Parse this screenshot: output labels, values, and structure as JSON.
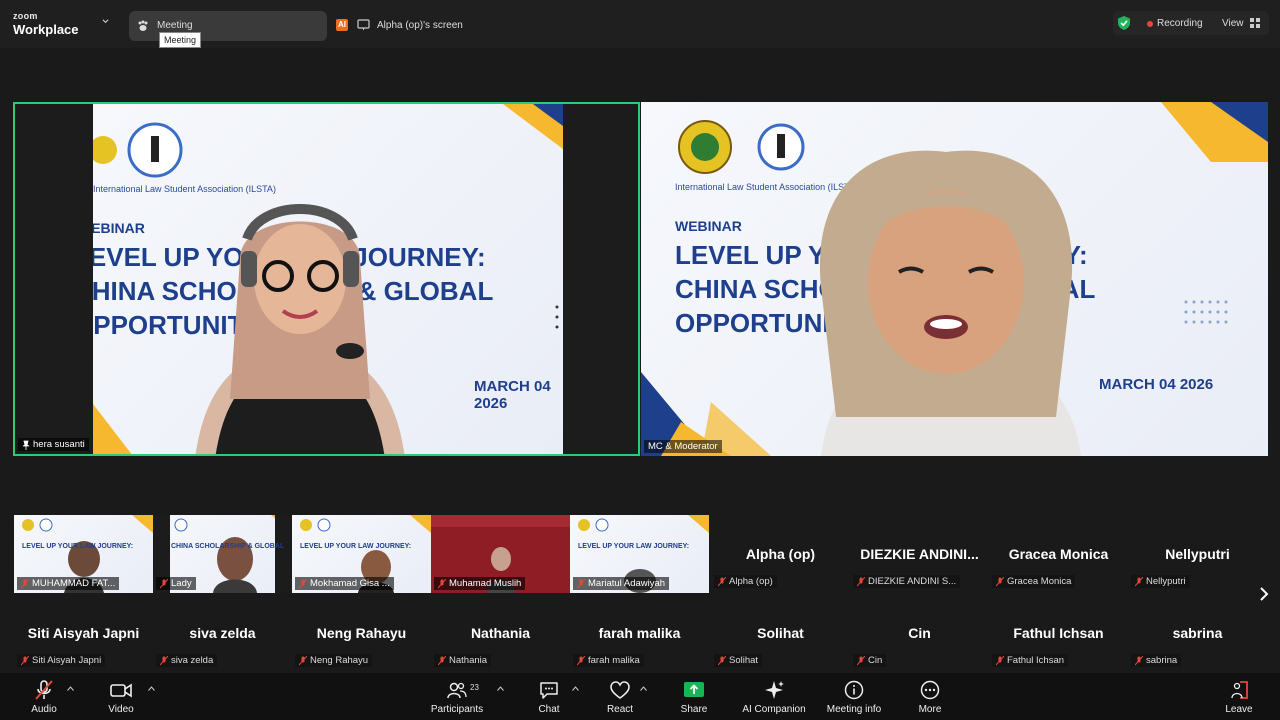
{
  "app": {
    "brand_small": "zoom",
    "brand": "Workplace"
  },
  "header": {
    "meeting_label": "Meeting",
    "tooltip": "Meeting",
    "ai_badge": "AI",
    "screen_share_label": "Alpha (op)'s screen",
    "recording_label": "Recording",
    "view_label": "View"
  },
  "slide": {
    "org": "International Law Student Association (ILSTA)",
    "webinar": "WEBINAR",
    "title_l1": "LEVEL UP YOUR LAW JOURNEY:",
    "title_l2": "CHINA SCHOLARSHIP & GLOBAL",
    "title_l3": "OPPORTUNITIES",
    "date": "MARCH 04 2026"
  },
  "main_tiles": [
    {
      "name": "hera susanti"
    },
    {
      "name": "MC & Moderator"
    }
  ],
  "gallery_row1": [
    {
      "name": "MUHAMMAD FAT..."
    },
    {
      "name": "Lady"
    },
    {
      "name": "Mokhamad Gisa ..."
    },
    {
      "name": "Muhamad Muslih"
    },
    {
      "name": "Mariatul Adawiyah"
    }
  ],
  "name_tiles_row1": [
    {
      "big": "Alpha (op)",
      "small": "Alpha (op)"
    },
    {
      "big": "DIEZKIE  ANDINI...",
      "small": "DIEZKIE ANDINI S..."
    },
    {
      "big": "Gracea Monica",
      "small": "Gracea Monica"
    },
    {
      "big": "Nellyputri",
      "small": "Nellyputri"
    }
  ],
  "name_tiles_row2": [
    {
      "big": "Siti Aisyah Japni",
      "small": "Siti Aisyah Japni"
    },
    {
      "big": "siva zelda",
      "small": "siva zelda"
    },
    {
      "big": "Neng Rahayu",
      "small": "Neng Rahayu"
    },
    {
      "big": "Nathania",
      "small": "Nathania"
    },
    {
      "big": "farah malika",
      "small": "farah malika"
    },
    {
      "big": "Solihat",
      "small": "Solihat"
    },
    {
      "big": "Cin",
      "small": "Cin"
    },
    {
      "big": "Fathul Ichsan",
      "small": "Fathul Ichsan"
    },
    {
      "big": "sabrina",
      "small": "sabrina"
    }
  ],
  "toolbar": {
    "audio": "Audio",
    "video": "Video",
    "participants": "Participants",
    "participants_count": "23",
    "chat": "Chat",
    "react": "React",
    "share": "Share",
    "ai_companion": "AI Companion",
    "meeting_info": "Meeting info",
    "more": "More",
    "leave": "Leave"
  },
  "colors": {
    "active_speaker": "#2ecc71",
    "share_green": "#19b456",
    "recording_red": "#e5483a",
    "slide_blue": "#1e3f8c"
  }
}
